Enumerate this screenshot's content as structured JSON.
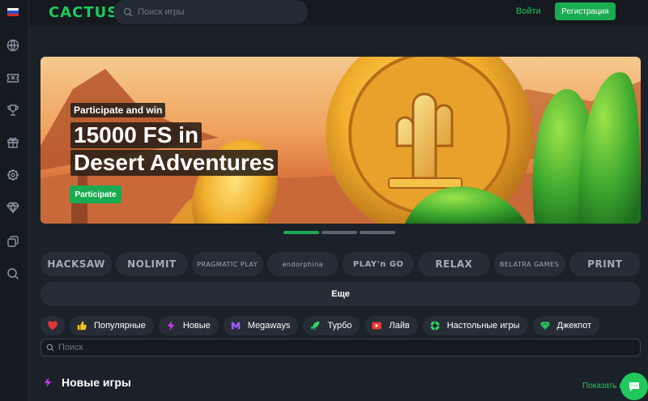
{
  "header": {
    "logo": "CACTUS",
    "search_placeholder": "Поиск игры",
    "login_label": "Войти",
    "register_label": "Регистрация"
  },
  "sidebar": {
    "language_flag": "ru-flag",
    "items": [
      {
        "icon": "globe-icon"
      },
      {
        "icon": "ticket-icon"
      },
      {
        "icon": "trophy-icon"
      },
      {
        "icon": "gift-box-icon"
      },
      {
        "icon": "vip-wheel-icon"
      },
      {
        "icon": "diamond-icon"
      },
      {
        "icon": "cards-icon"
      },
      {
        "icon": "search-icon"
      }
    ]
  },
  "banner": {
    "tag": "Participate and win",
    "title_line1": "15000 FS in",
    "title_line2": "Desert Adventures",
    "cta_label": "Participate",
    "active_slide": 1,
    "slide_count": 3
  },
  "providers": [
    {
      "label": "HACKSAW"
    },
    {
      "label": "NOLIMIT"
    },
    {
      "label": "PRAGMATIC PLAY"
    },
    {
      "label": "endorphina"
    },
    {
      "label": "PLAY'n GO"
    },
    {
      "label": "RELAX"
    },
    {
      "label": "BELATRA GAMES"
    },
    {
      "label": "PRINT"
    }
  ],
  "more_label": "Еще",
  "categories": [
    {
      "label": "",
      "icon": "heart-icon"
    },
    {
      "label": "Популярные",
      "icon": "thumbs-up-icon"
    },
    {
      "label": "Новые",
      "icon": "lightning-icon"
    },
    {
      "label": "Megaways",
      "icon": "megaways-icon"
    },
    {
      "label": "Турбо",
      "icon": "rocket-icon"
    },
    {
      "label": "Лайв",
      "icon": "live-icon"
    },
    {
      "label": "Настольные игры",
      "icon": "chip-icon"
    },
    {
      "label": "Джекпот",
      "icon": "diamond-icon"
    }
  ],
  "game_search_placeholder": "Поиск",
  "section": {
    "title": "Новые игры",
    "show_all": "Показать все"
  },
  "colors": {
    "accent": "#1fc95c",
    "button": "#1aaa52",
    "background": "#1b2128",
    "panel": "#262d36"
  }
}
